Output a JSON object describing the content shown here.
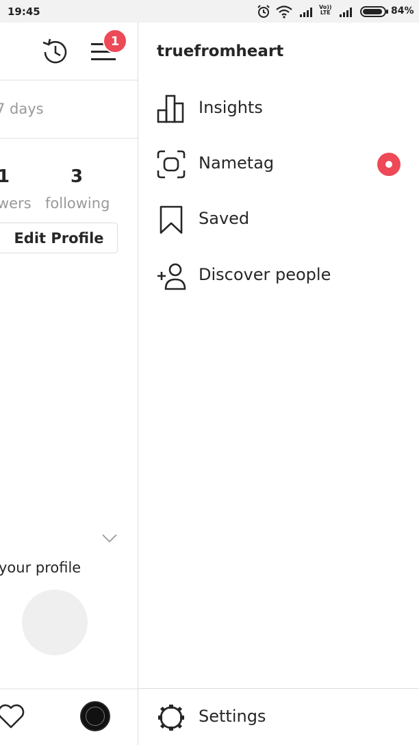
{
  "status_bar": {
    "time": "19:45",
    "lte_label_top": "Vo))",
    "lte_label_bottom": "LTE",
    "battery_percent": "84%",
    "icons": [
      "alarm-icon",
      "wifi-icon",
      "signal-icon",
      "signal-icon",
      "battery-icon"
    ]
  },
  "profile_background": {
    "header_icons": [
      "history-icon",
      "hamburger-menu-icon"
    ],
    "notification_badge": "1",
    "activity_text": "7 days",
    "stats": [
      {
        "number": "1",
        "label": "wers"
      },
      {
        "number": "3",
        "label": "following"
      }
    ],
    "edit_profile_label": "Edit Profile",
    "complete_profile_text": "your profile",
    "bottom_nav_icons": [
      "heart-icon",
      "profile-avatar"
    ]
  },
  "drawer": {
    "username": "truefromheart",
    "menu_items": [
      {
        "label": "Insights",
        "icon": "insights-bar-chart-icon"
      },
      {
        "label": "Nametag",
        "icon": "nametag-icon",
        "has_notification_dot": true
      },
      {
        "label": "Saved",
        "icon": "bookmark-icon"
      },
      {
        "label": "Discover people",
        "icon": "add-person-icon"
      }
    ],
    "settings_label": "Settings",
    "settings_icon": "settings-gear-icon"
  },
  "colors": {
    "accent_red": "#ed4956",
    "text_primary": "#262626",
    "text_secondary": "#999999",
    "divider": "#dbdbdb"
  }
}
